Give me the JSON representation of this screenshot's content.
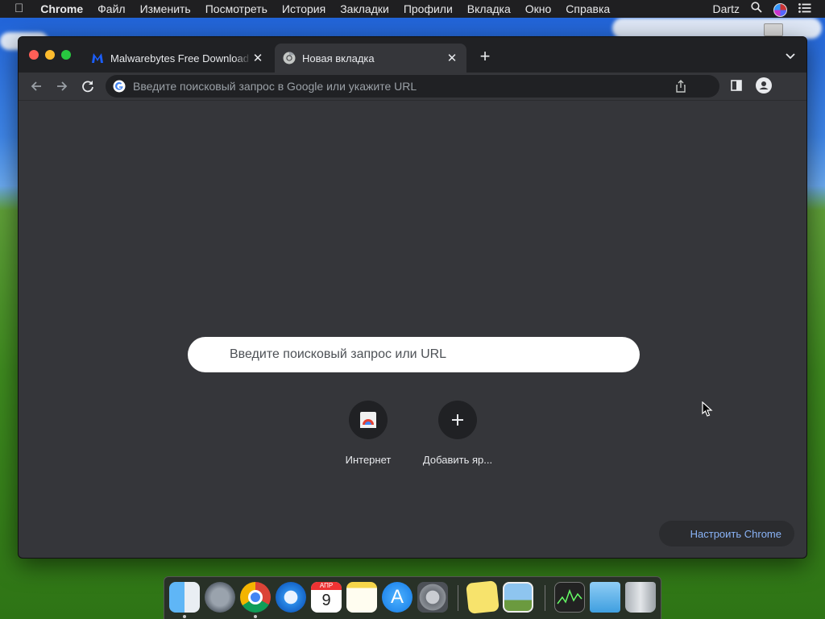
{
  "menubar": {
    "app": "Chrome",
    "items": [
      "Файл",
      "Изменить",
      "Посмотреть",
      "История",
      "Закладки",
      "Профили",
      "Вкладка",
      "Окно",
      "Справка"
    ],
    "user": "Dartz"
  },
  "tabs": [
    {
      "title": "Malwarebytes Free Download f",
      "icon": "malwarebytes-icon",
      "active": false
    },
    {
      "title": "Новая вкладка",
      "icon": "chrome-icon",
      "active": true
    }
  ],
  "toolbar": {
    "omnibox_placeholder": "Введите поисковый запрос в Google или укажите URL"
  },
  "ntp": {
    "search_placeholder": "Введите поисковый запрос или URL",
    "shortcuts": [
      {
        "label": "Интернет",
        "icon": "internet-icon"
      },
      {
        "label": "Добавить яр...",
        "icon": "plus-icon"
      }
    ],
    "customize_label": "Настроить Chrome"
  },
  "dock": {
    "apps": [
      "finder",
      "launchpad",
      "chrome",
      "safari",
      "calendar",
      "notes",
      "app-store",
      "system-preferences",
      "stickies",
      "preview",
      "activity-monitor",
      "downloads-folder",
      "trash"
    ],
    "calendar_month": "АПР",
    "calendar_day": "9"
  },
  "colors": {
    "window_bg": "#35363a",
    "tabstrip_bg": "#202124",
    "accent_link": "#8ab4f8",
    "menubar_bg": "#1f1f21"
  }
}
